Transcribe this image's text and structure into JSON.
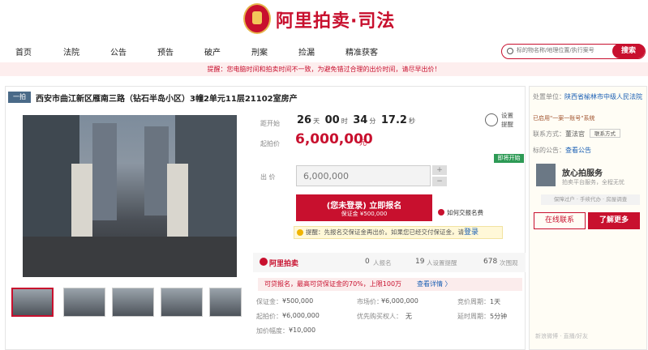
{
  "brand": {
    "name": "阿里拍卖·司法"
  },
  "nav": {
    "items": [
      "首页",
      "法院",
      "公告",
      "预告",
      "破产",
      "刑案",
      "捡漏",
      "精准获客"
    ]
  },
  "search": {
    "placeholder": "标的物名称/地理位置/执行案号",
    "button": "搜索"
  },
  "notice": "提醒：您电脑时间和拍卖时间不一致，为避免错过合理的出价时间，请尽早出价！",
  "item": {
    "round": "一拍",
    "title": "西安市曲江新区雁南三路（钻石半岛小区）3幢2单元11层21102室房产"
  },
  "auction": {
    "countdown_label": "距开始",
    "days": "26",
    "days_unit": "天",
    "hours": "00",
    "hours_unit": "时",
    "minutes": "34",
    "minutes_unit": "分",
    "seconds": "17.2",
    "seconds_unit": "秒",
    "remind": "设置提醒",
    "start_price_label": "起拍价",
    "start_price": "6,000,000",
    "price_unit": "元",
    "signup_tag": "即将开始",
    "bid_label": "出 价",
    "bid_value": "6,000,000",
    "plus": "+",
    "minus": "−",
    "register_main": "(您未登录) 立即报名",
    "register_sub": "保证金 ¥500,000",
    "deposit_help": "如何交报名费",
    "tip": "提醒：先报名交保证金再出价。如果您已经交付保证金，请",
    "tip_link": "登录"
  },
  "stats": {
    "logo": "阿里拍卖",
    "applicants": "0",
    "applicants_label": "人报名",
    "reminders": "19",
    "reminders_label": "人设置提醒",
    "views": "678",
    "views_label": "次围观"
  },
  "pay_promo": {
    "text": "可贷报名，最高可贷保证金的70%，上限100万",
    "link": "查看详情 〉"
  },
  "details": [
    {
      "label": "保证金：",
      "value": "¥500,000"
    },
    {
      "label": "市场价：",
      "value": "¥6,000,000"
    },
    {
      "label": "竞价周期：",
      "value": "1天"
    },
    {
      "label": "起拍价：",
      "value": "¥6,000,000"
    },
    {
      "label": "优先购买权人：",
      "value": "无"
    },
    {
      "label": "延时周期：",
      "value": "5分钟"
    },
    {
      "label": "加价幅度：",
      "value": "¥10,000"
    }
  ],
  "right": {
    "unit_label": "处置单位：",
    "unit_value": "陕西省榆林市中级人民法院",
    "certified": "已启用\"一案一账号\"系统",
    "contact_label": "联系方式：",
    "contact_value": "董法官",
    "contact_btn": "联系方式",
    "notice_label": "标的公告：",
    "notice_link": "查看公告",
    "service_title": "放心拍服务",
    "service_sub": "拍卖平台服务，全程无忧",
    "service_tag": "保障过户 · 手续代办 · 房屋调查",
    "online_btn": "在线联系",
    "learn_btn": "了解更多",
    "footer": "新浪微博 · 直播/好友"
  },
  "colors": {
    "brand": "#c8102e",
    "green": "#2d9a55"
  }
}
